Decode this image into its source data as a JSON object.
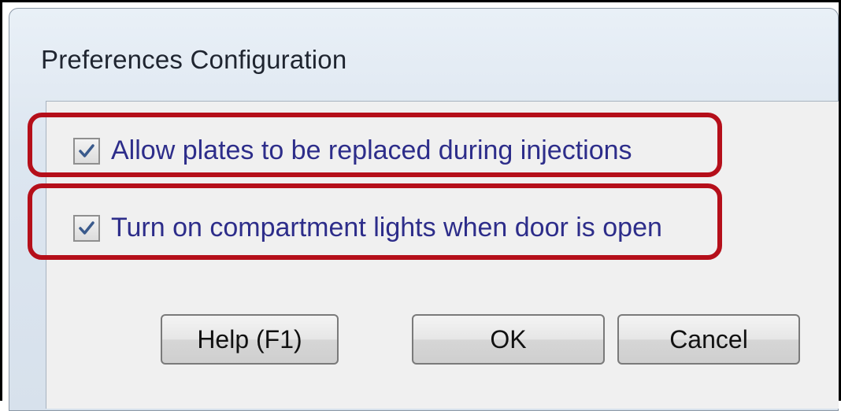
{
  "window": {
    "title": "Preferences Configuration"
  },
  "options": [
    {
      "label": "Allow plates to be replaced during injections",
      "checked": true
    },
    {
      "label": "Turn on compartment lights when door is open",
      "checked": true
    }
  ],
  "buttons": {
    "help": "Help (F1)",
    "ok": "OK",
    "cancel": "Cancel"
  },
  "colors": {
    "highlight": "#b50f1a",
    "label_text": "#2d2d8a"
  }
}
